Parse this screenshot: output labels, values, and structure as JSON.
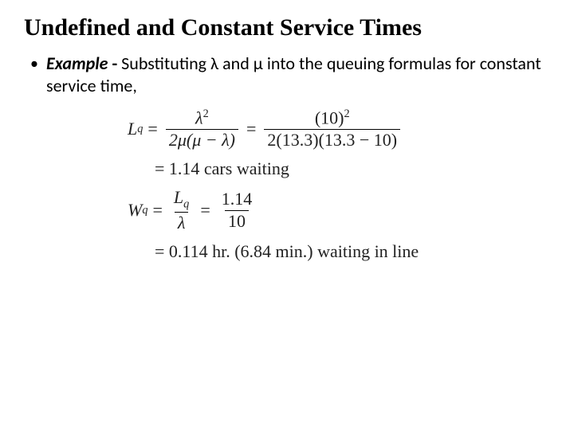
{
  "title": "Undefined and Constant Service Times",
  "bullet": {
    "label": "Example",
    "dash": " - ",
    "text": "Substituting λ and μ into the queuing formulas for constant service time,"
  },
  "math": {
    "lq_lhs": "L",
    "lq_sub": "q",
    "eq": "=",
    "frac1_num_sym": "λ",
    "frac1_num_sup": "2",
    "frac1_den": "2μ(μ − λ)",
    "frac2_num": "(10)",
    "frac2_num_sup": "2",
    "frac2_den": "2(13.3)(13.3 − 10)",
    "lq_result": "= 1.14 cars waiting",
    "wq_lhs": "W",
    "wq_sub": "q",
    "frac3_num_sym": "L",
    "frac3_num_sub": "q",
    "frac3_den": "λ",
    "frac4_num": "1.14",
    "frac4_den": "10",
    "wq_result": "= 0.114 hr. (6.84 min.) waiting in line"
  }
}
